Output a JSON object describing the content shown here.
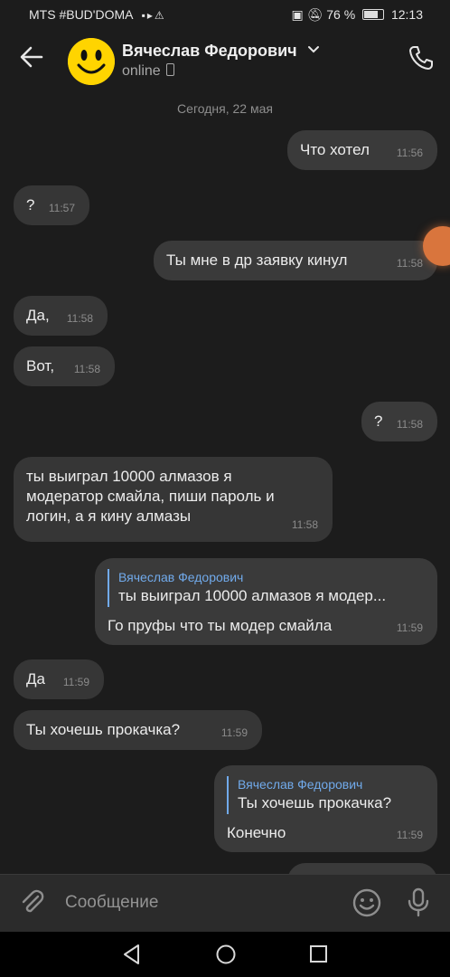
{
  "status_bar": {
    "carrier": "MTS #BUD'DOMA",
    "battery": "76 %",
    "battery_level": 0.76,
    "time": "12:13"
  },
  "header": {
    "name": "Вячеслав Федорович",
    "status": "online"
  },
  "date_separator": "Сегодня, 22 мая",
  "messages": [
    {
      "text": "Что хотел",
      "time": "11:56"
    },
    {
      "text": "?",
      "time": "11:57"
    },
    {
      "text": "Ты мне в др заявку кинул",
      "time": "11:58"
    },
    {
      "text": "Да,",
      "time": "11:58"
    },
    {
      "text": "Вот,",
      "time": "11:58"
    },
    {
      "text": "?",
      "time": "11:58"
    },
    {
      "text": "ты выиграл 10000 алмазов я\nмодератор смайла, пиши пароль и\nлогин, а я кину алмазы",
      "time": "11:58"
    },
    {
      "reply_author": "Вячеслав Федорович",
      "reply_text": "ты выиграл 10000 алмазов я модер...",
      "text": "Го пруфы что ты модер смайла",
      "time": "11:59"
    },
    {
      "text": "Да",
      "time": "11:59"
    },
    {
      "text": "Ты хочешь прокачка?",
      "time": "11:59"
    },
    {
      "reply_author": "Вячеслав Федорович",
      "reply_text": "Ты хочешь прокачка?",
      "text": "Конечно",
      "time": "11:59"
    }
  ],
  "input": {
    "placeholder": "Сообщение"
  }
}
